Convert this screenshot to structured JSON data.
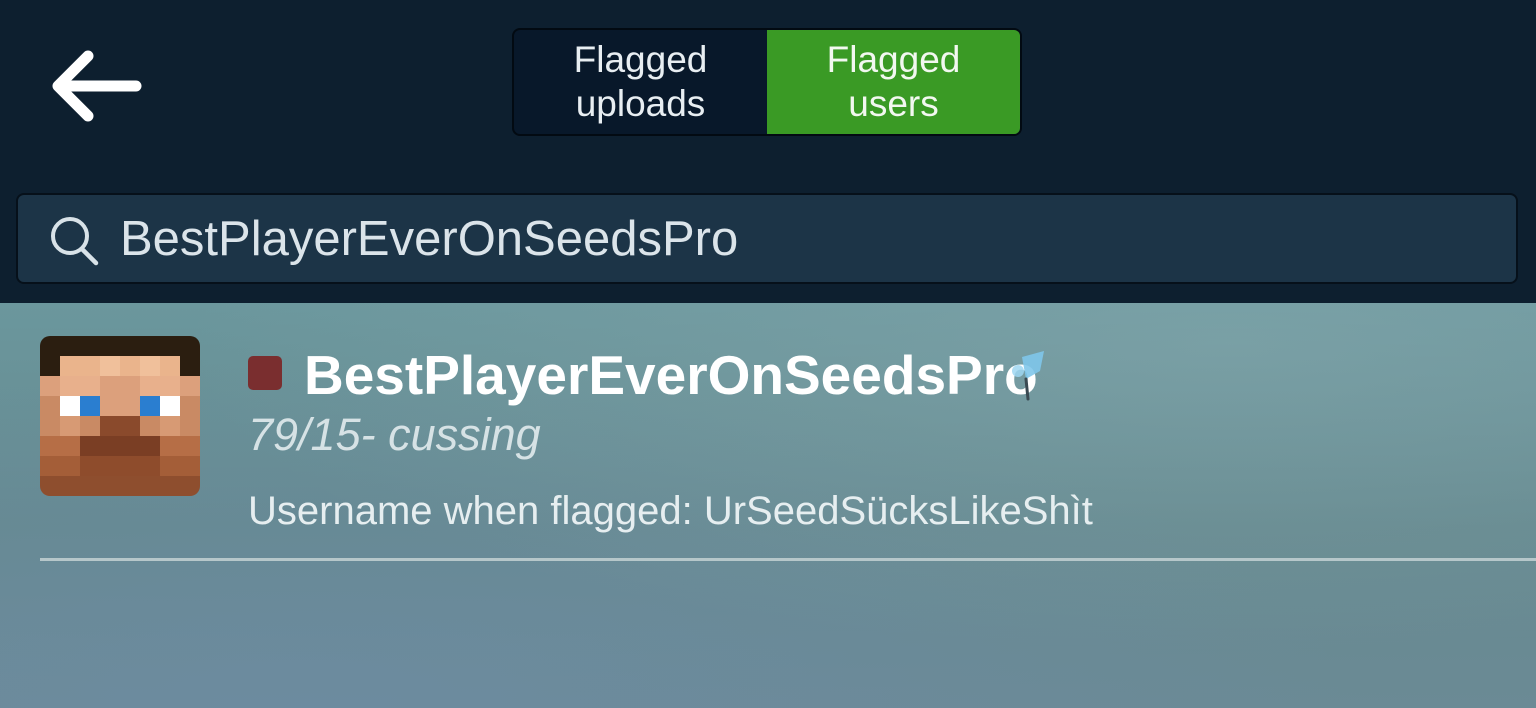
{
  "header": {
    "back_icon": "arrow-left-icon",
    "tabs": [
      {
        "label": "Flagged\nuploads",
        "active": false
      },
      {
        "label": "Flagged\nusers",
        "active": true
      }
    ],
    "active_tab_color": "#3a9a25"
  },
  "search": {
    "icon": "search-icon",
    "value": "BestPlayerEverOnSeedsPro"
  },
  "results": [
    {
      "avatar": "minecraft-steve-avatar",
      "status_color": "#7a2e2f",
      "username": "BestPlayerEverOnSeedsPro",
      "badge_icon": "map-pin-icon",
      "flag_reason": "79/15- cussing",
      "flagged_username": "Username when flagged: UrSeedSücksLikeShìt"
    }
  ]
}
